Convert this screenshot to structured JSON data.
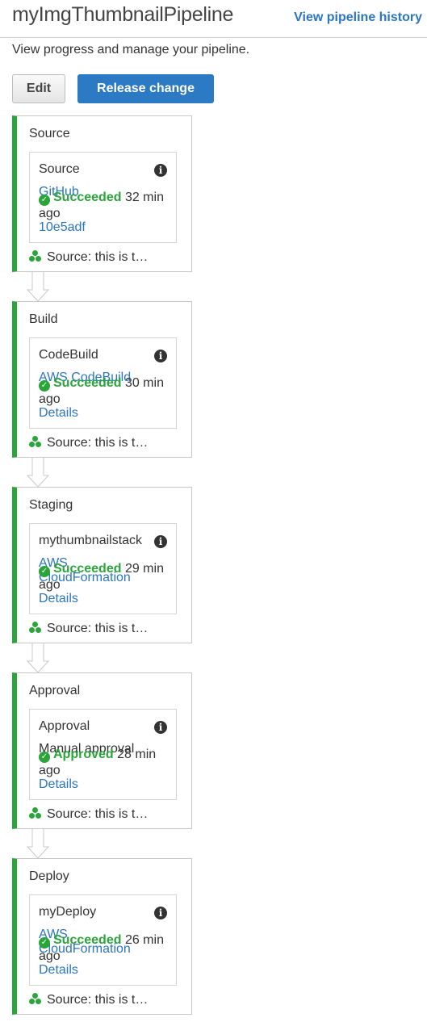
{
  "header": {
    "title": "myImgThumbnailPipeline",
    "history_link": "View pipeline history",
    "subtitle": "View progress and manage your pipeline."
  },
  "toolbar": {
    "edit_label": "Edit",
    "release_label": "Release change"
  },
  "colors": {
    "success": "#2aa53a",
    "link": "#2b76c0",
    "primary_button": "#2d7ac4"
  },
  "icons": {
    "info": "info-icon",
    "status": "check-circle-icon",
    "commit": "commit-icon"
  },
  "stages": [
    {
      "name": "Source",
      "action": {
        "name": "Source",
        "provider": "GitHub",
        "status": "Succeeded",
        "time": "32 min ago",
        "link": "10e5adf"
      },
      "source_text": "Source: this is t…"
    },
    {
      "name": "Build",
      "action": {
        "name": "CodeBuild",
        "provider": "AWS CodeBuild",
        "status": "Succeeded",
        "time": "30 min ago",
        "link": "Details"
      },
      "source_text": "Source: this is t…"
    },
    {
      "name": "Staging",
      "action": {
        "name": "mythumbnailstack",
        "provider": "AWS CloudFormation",
        "status": "Succeeded",
        "time": "29 min ago",
        "link": "Details"
      },
      "source_text": "Source: this is t…"
    },
    {
      "name": "Approval",
      "action": {
        "name": "Approval",
        "provider": "Manual approval",
        "status": "Approved",
        "time": "28 min ago",
        "link": "Details"
      },
      "source_text": "Source: this is t…"
    },
    {
      "name": "Deploy",
      "action": {
        "name": "myDeploy",
        "provider": "AWS CloudFormation",
        "status": "Succeeded",
        "time": "26 min ago",
        "link": "Details"
      },
      "source_text": "Source: this is t…"
    }
  ]
}
